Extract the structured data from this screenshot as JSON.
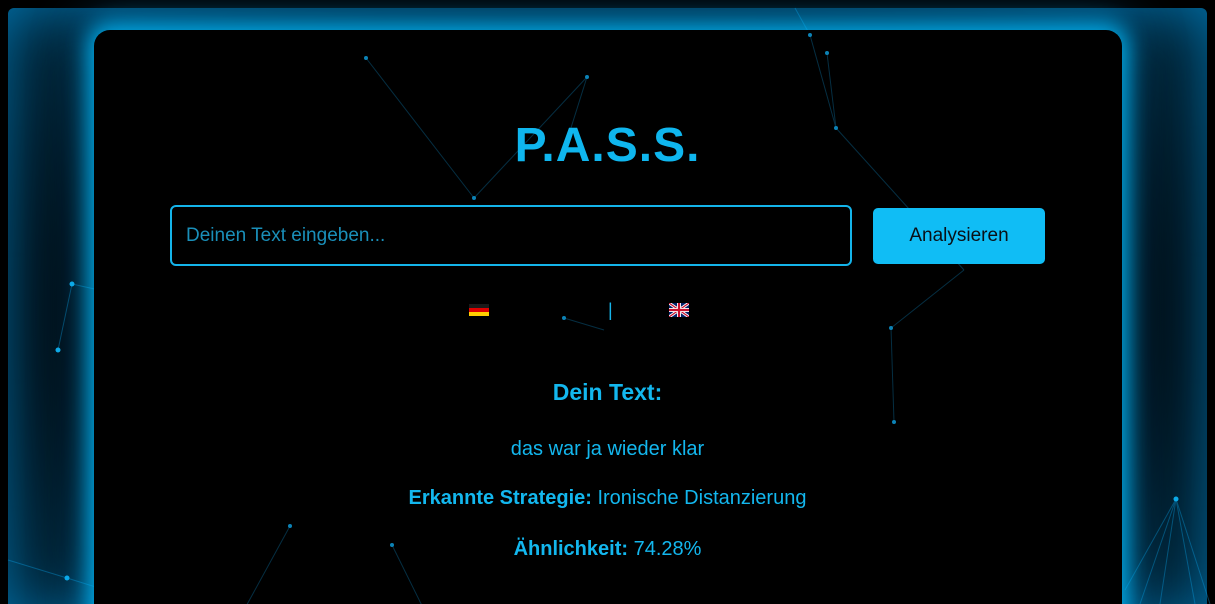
{
  "app": {
    "title": "P.A.S.S."
  },
  "search": {
    "placeholder": "Deinen Text eingeben...",
    "value": "",
    "button_label": "Analysieren"
  },
  "languages": {
    "separator": "|",
    "items": [
      {
        "code": "de",
        "icon": "flag-germany-icon"
      },
      {
        "code": "en",
        "icon": "flag-uk-icon"
      }
    ]
  },
  "result": {
    "heading": "Dein Text:",
    "text": "das war ja wieder klar",
    "strategy_label": "Erkannte Strategie:",
    "strategy_value": "Ironische Distanzierung",
    "similarity_label": "Ähnlichkeit:",
    "similarity_value": "74.28%"
  },
  "colors": {
    "accent": "#10bdf5",
    "background": "#000000",
    "glow": "#00b4ff"
  }
}
